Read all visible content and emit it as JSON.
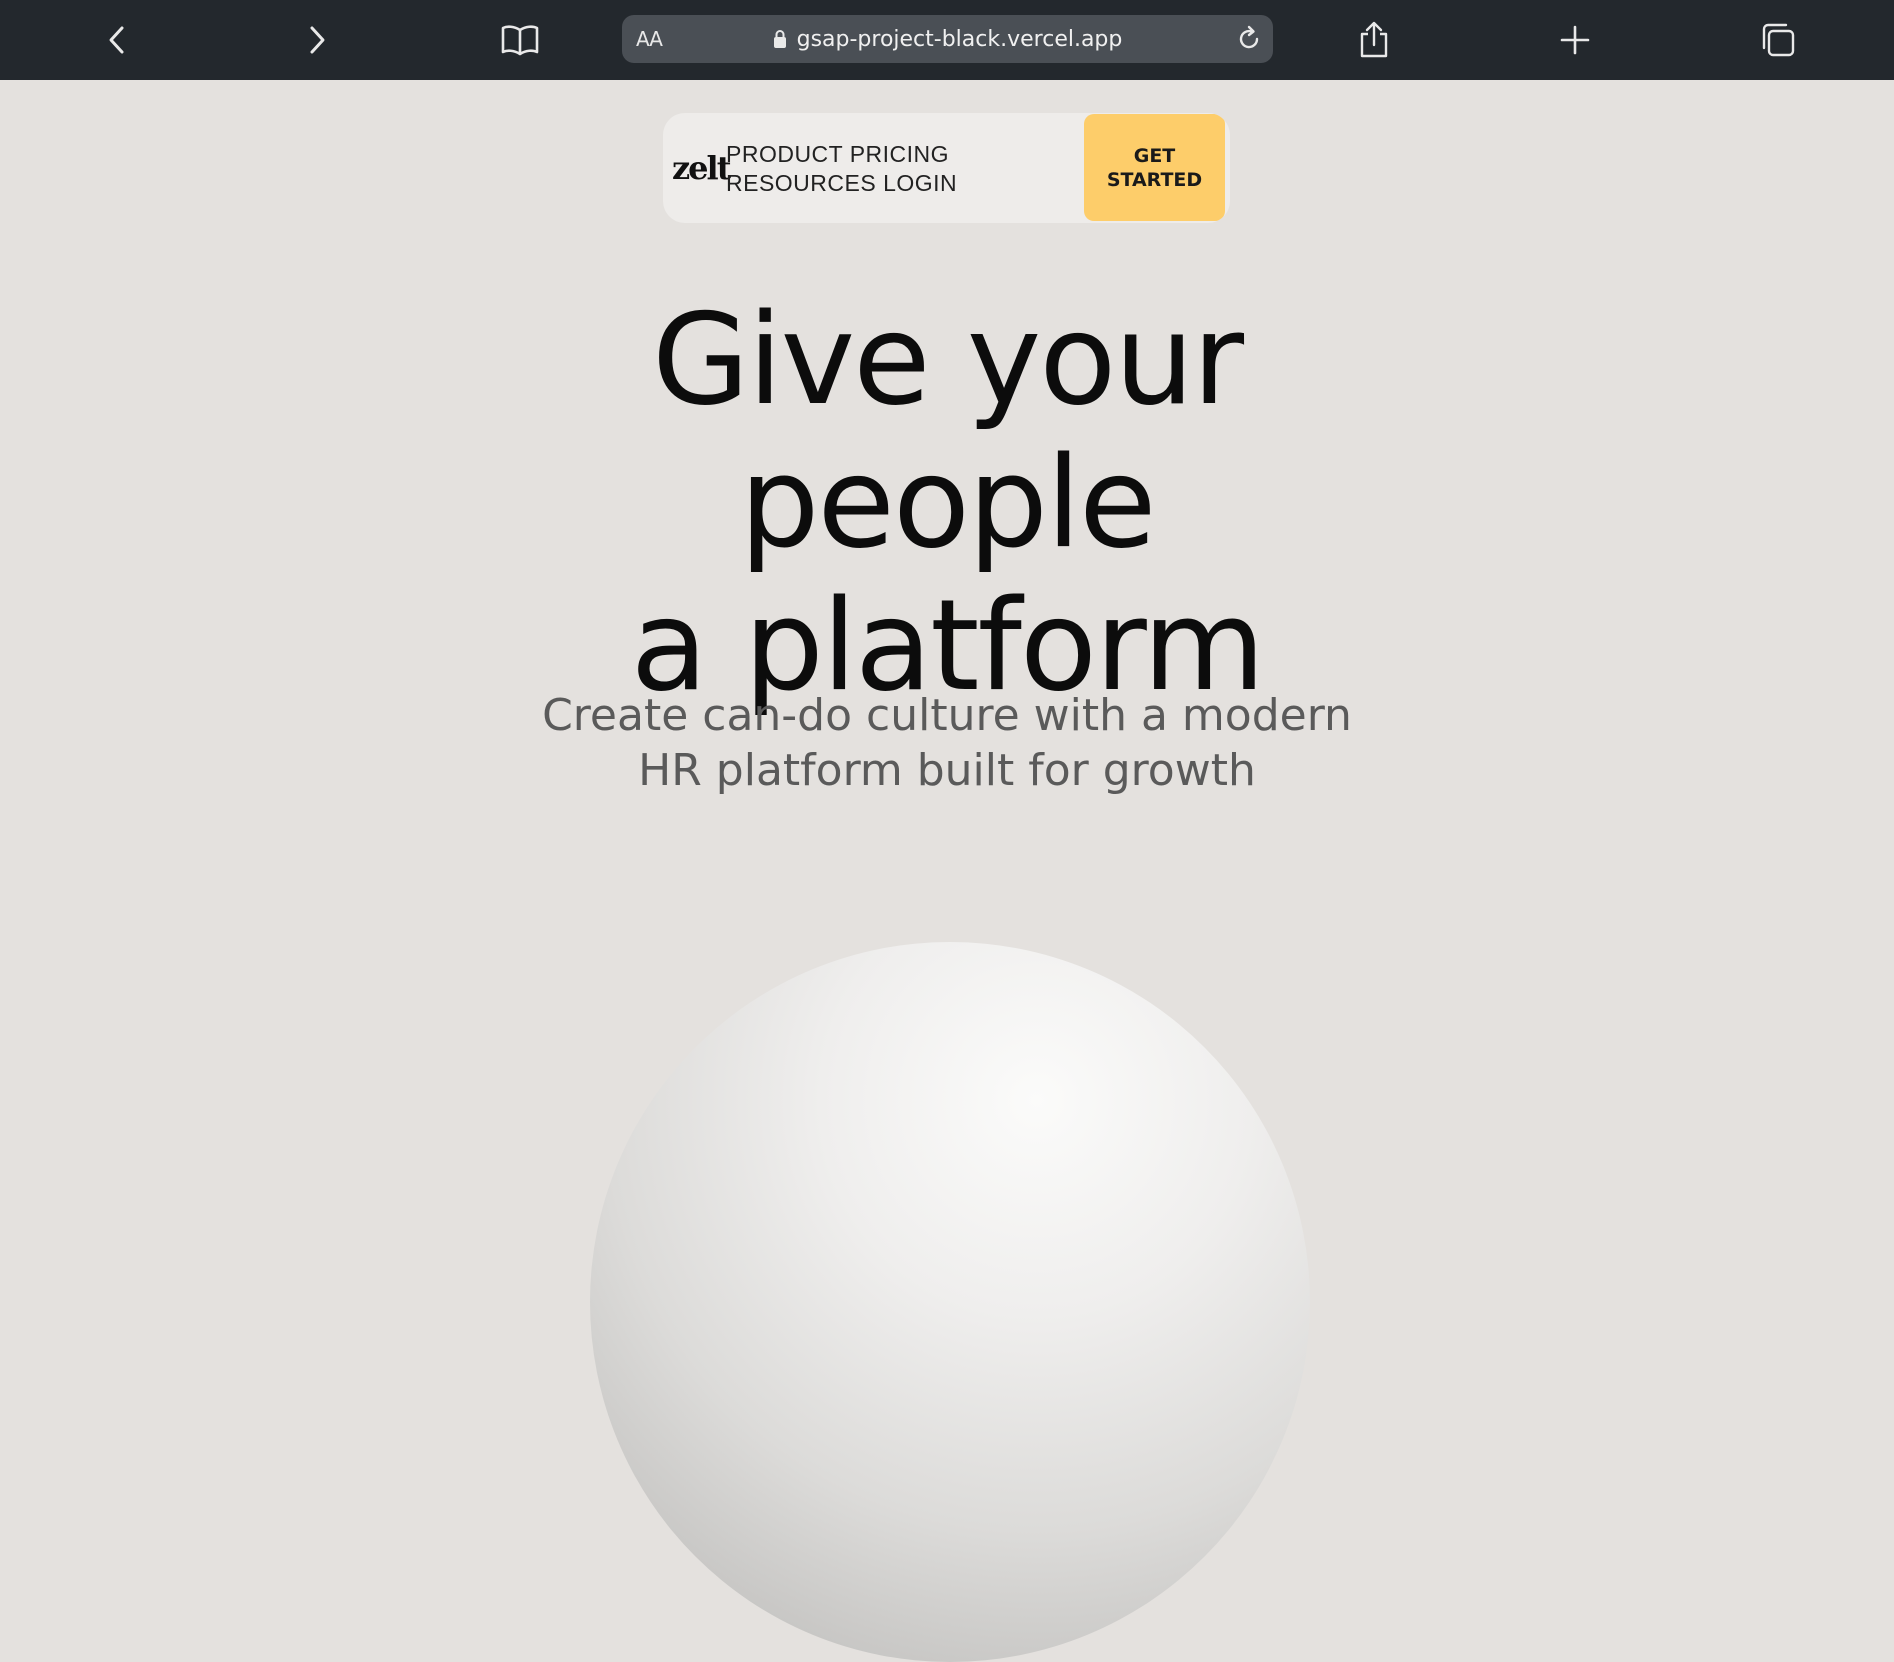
{
  "browser": {
    "aa_label": "AA",
    "url": "gsap-project-black.vercel.app",
    "icons": {
      "back": "chevron-left-icon",
      "forward": "chevron-right-icon",
      "bookmarks": "book-icon",
      "lock": "lock-icon",
      "reload": "reload-icon",
      "share": "share-icon",
      "new_tab": "plus-icon",
      "tabs": "tabs-icon"
    }
  },
  "nav": {
    "logo": "zelt",
    "links": [
      "PRODUCT",
      "PRICING",
      "RESOURCES",
      "LOGIN"
    ],
    "cta_label": "GET STARTED"
  },
  "hero": {
    "line1": "Give your",
    "line2": "people",
    "line3": "a platform",
    "subtitle_line1": "Create can-do culture with a modern",
    "subtitle_line2": "HR platform built for growth"
  },
  "colors": {
    "topbar": "#23282d",
    "page_bg": "#e4e1de",
    "cta_bg": "#fdcd6a",
    "heading": "#0c0c0c",
    "subtitle": "#5a5a5a"
  }
}
